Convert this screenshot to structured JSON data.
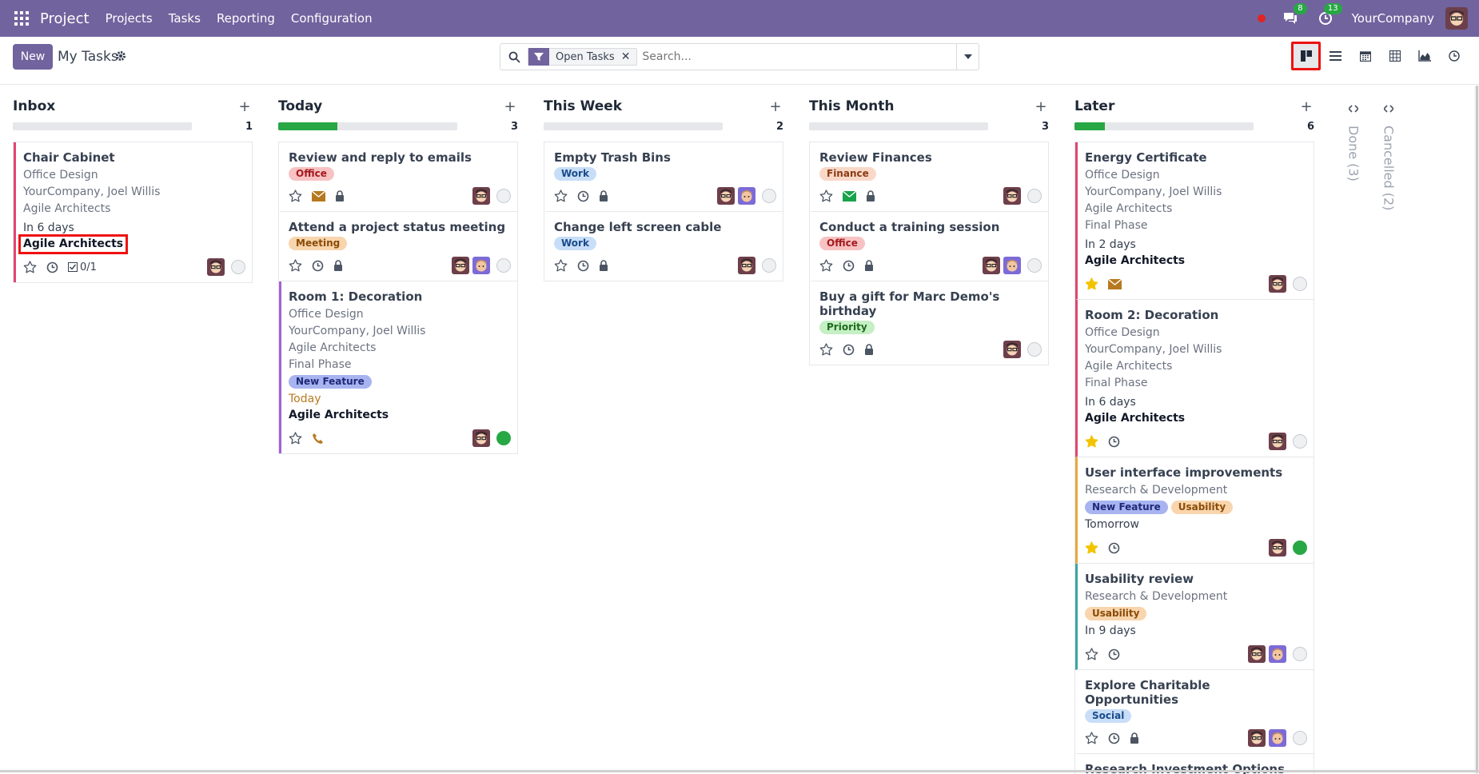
{
  "nav": {
    "brand": "Project",
    "menu": [
      "Projects",
      "Tasks",
      "Reporting",
      "Configuration"
    ],
    "messages_badge": "8",
    "activity_badge": "13",
    "company": "YourCompany"
  },
  "control": {
    "new_label": "New",
    "title": "My Tasks",
    "facet_label": "Open Tasks",
    "search_placeholder": "Search..."
  },
  "views": [
    "kanban",
    "list",
    "calendar",
    "pivot",
    "graph",
    "activity"
  ],
  "columns": [
    {
      "title": "Inbox",
      "count": "1",
      "progress": 0,
      "cards": [
        {
          "title": "Chair Cabinet",
          "lines": [
            "Office Design",
            "YourCompany, Joel Willis",
            "Agile Architects"
          ],
          "date": "In 6 days",
          "project": "Agile Architects",
          "project_highlight": true,
          "subtasks": "0/1",
          "accent": "#e2466e",
          "avatars": 1
        }
      ]
    },
    {
      "title": "Today",
      "count": "3",
      "progress": 33,
      "cards": [
        {
          "title": "Review and reply to emails",
          "tags": [
            {
              "label": "Office",
              "bg": "#f8c2c2",
              "fg": "#a4191f"
            }
          ],
          "icons": [
            "star",
            "envelope",
            "lock"
          ],
          "avatars": 1
        },
        {
          "title": "Attend a project status meeting",
          "tags": [
            {
              "label": "Meeting",
              "bg": "#f8d5ad",
              "fg": "#8a4b06"
            }
          ],
          "icons": [
            "star",
            "clock",
            "lock"
          ],
          "avatars": 2
        },
        {
          "title": "Room 1: Decoration",
          "lines": [
            "Office Design",
            "YourCompany, Joel Willis",
            "Agile Architects",
            "Final Phase"
          ],
          "tags": [
            {
              "label": "New Feature",
              "bg": "#a8b4f0",
              "fg": "#1e2a78"
            }
          ],
          "date": "Today",
          "date_today": true,
          "project": "Agile Architects",
          "icons": [
            "star",
            "phone"
          ],
          "accent": "#a560d8",
          "avatars": 1,
          "status": "green"
        }
      ]
    },
    {
      "title": "This Week",
      "count": "2",
      "progress": 0,
      "cards": [
        {
          "title": "Empty Trash Bins",
          "tags": [
            {
              "label": "Work",
              "bg": "#c8def8",
              "fg": "#1a4b8a"
            }
          ],
          "icons": [
            "star",
            "clock",
            "lock"
          ],
          "avatars": 2
        },
        {
          "title": "Change left screen cable",
          "tags": [
            {
              "label": "Work",
              "bg": "#c8def8",
              "fg": "#1a4b8a"
            }
          ],
          "icons": [
            "star",
            "clock",
            "lock"
          ],
          "avatars": 1
        }
      ]
    },
    {
      "title": "This Month",
      "count": "3",
      "progress": 0,
      "cards": [
        {
          "title": "Review Finances",
          "tags": [
            {
              "label": "Finance",
              "bg": "#f9d8c8",
              "fg": "#8a3b12"
            }
          ],
          "icons": [
            "star",
            "envelope-green",
            "lock"
          ],
          "avatars": 1
        },
        {
          "title": "Conduct a training session",
          "tags": [
            {
              "label": "Office",
              "bg": "#f8c2c2",
              "fg": "#a4191f"
            }
          ],
          "icons": [
            "star",
            "clock",
            "lock"
          ],
          "avatars": 2
        },
        {
          "title": "Buy a gift for Marc Demo's birthday",
          "tags": [
            {
              "label": "Priority",
              "bg": "#c5efc4",
              "fg": "#1f6a1d"
            }
          ],
          "icons": [
            "star",
            "clock",
            "lock"
          ],
          "avatars": 1
        }
      ]
    },
    {
      "title": "Later",
      "count": "6",
      "progress": 17,
      "cards": [
        {
          "title": "Energy Certificate",
          "lines": [
            "Office Design",
            "YourCompany, Joel Willis",
            "Agile Architects",
            "Final Phase"
          ],
          "date": "In 2 days",
          "project": "Agile Architects",
          "icons": [
            "star-filled",
            "envelope"
          ],
          "accent": "#e2466e",
          "avatars": 1
        },
        {
          "title": "Room 2: Decoration",
          "lines": [
            "Office Design",
            "YourCompany, Joel Willis",
            "Agile Architects",
            "Final Phase"
          ],
          "date": "In 6 days",
          "project": "Agile Architects",
          "icons": [
            "star-filled",
            "clock"
          ],
          "accent": "#e2466e",
          "avatars": 1
        },
        {
          "title": "User interface improvements",
          "lines": [
            "Research & Development"
          ],
          "tags": [
            {
              "label": "New Feature",
              "bg": "#a8b4f0",
              "fg": "#1e2a78"
            },
            {
              "label": "Usability",
              "bg": "#f8d5ad",
              "fg": "#8a4b06"
            }
          ],
          "date": "Tomorrow",
          "icons": [
            "star-filled",
            "clock"
          ],
          "accent": "#e8a93b",
          "avatars": 1,
          "status": "green"
        },
        {
          "title": "Usability review",
          "lines": [
            "Research & Development"
          ],
          "tags": [
            {
              "label": "Usability",
              "bg": "#f8d5ad",
              "fg": "#8a4b06"
            }
          ],
          "date": "In 9 days",
          "icons": [
            "star",
            "clock"
          ],
          "accent": "#3aa7a3",
          "avatars": 2
        },
        {
          "title": "Explore Charitable Opportunities",
          "tags": [
            {
              "label": "Social",
              "bg": "#c8def8",
              "fg": "#1a4b8a"
            }
          ],
          "icons": [
            "star",
            "clock",
            "lock"
          ],
          "avatars": 2
        },
        {
          "title": "Research Investment Options",
          "icons": [],
          "avatars": 0
        }
      ]
    }
  ],
  "folded": [
    {
      "label": "Done (3)"
    },
    {
      "label": "Cancelled (2)"
    }
  ]
}
